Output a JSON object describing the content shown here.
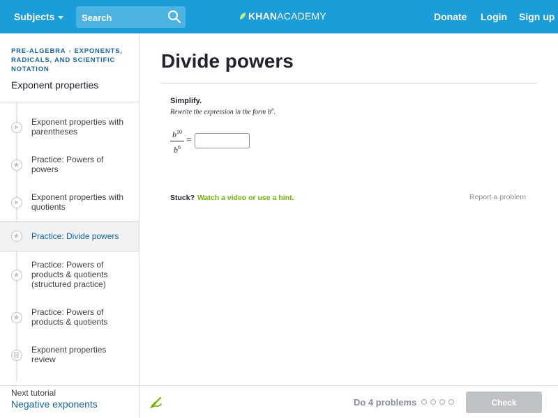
{
  "header": {
    "subjects_label": "Subjects",
    "search_placeholder": "Search",
    "logo_bold": "KHAN",
    "logo_light": "ACADEMY",
    "donate_label": "Donate",
    "login_label": "Login",
    "signup_label": "Sign up"
  },
  "sidebar": {
    "breadcrumb": [
      "PRE-ALGEBRA",
      "EXPONENTS, RADICALS, AND SCIENTIFIC NOTATION"
    ],
    "tutorial_title": "Exponent properties",
    "items": [
      {
        "label": "Exponent properties with parentheses",
        "kind": "video",
        "active": false
      },
      {
        "label": "Practice: Powers of powers",
        "kind": "practice",
        "active": false
      },
      {
        "label": "Exponent properties with quotients",
        "kind": "video",
        "active": false
      },
      {
        "label": "Practice: Divide powers",
        "kind": "practice",
        "active": true
      },
      {
        "label": "Practice: Powers of products & quotients (structured practice)",
        "kind": "practice",
        "active": false
      },
      {
        "label": "Practice: Powers of products & quotients",
        "kind": "practice",
        "active": false
      },
      {
        "label": "Exponent properties review",
        "kind": "article",
        "active": false
      }
    ],
    "next_label": "Next tutorial",
    "next_link": "Negative exponents"
  },
  "main": {
    "title": "Divide powers",
    "question_heading": "Simplify.",
    "instruction_prefix": "Rewrite the expression in the form ",
    "instruction_form": "b",
    "instruction_form_exp": "n",
    "instruction_suffix": ".",
    "numerator_base": "b",
    "numerator_exp": "10",
    "denominator_base": "b",
    "denominator_exp": "6",
    "equals": "=",
    "answer_value": "",
    "stuck_label": "Stuck?",
    "hint_link": "Watch a video or use a hint.",
    "report_link": "Report a problem"
  },
  "footer": {
    "do_problems": "Do 4 problems",
    "total_problems": 4,
    "completed_problems": 0,
    "check_label": "Check"
  },
  "colors": {
    "header_bg": "#1a9dd9",
    "link_blue": "#1865a2",
    "hint_green": "#71b307",
    "check_disabled": "#bfc2c4"
  }
}
